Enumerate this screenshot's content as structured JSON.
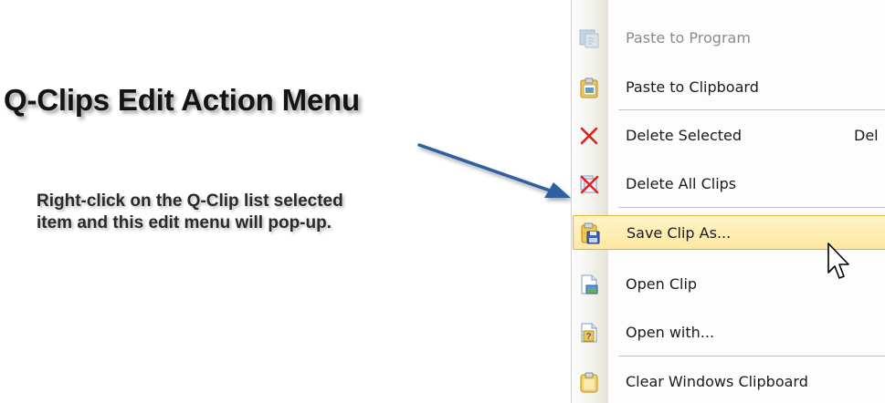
{
  "heading": "Q-Clips Edit Action Menu",
  "description": [
    "Right-click on the Q-Clip list selected",
    "item and this edit menu will pop-up."
  ],
  "menu": {
    "items": [
      {
        "label": "Paste to Program",
        "icon": "paste-to-program-icon",
        "state": "disabled"
      },
      {
        "label": "Paste to Clipboard",
        "icon": "clipboard-icon"
      },
      {
        "label": "Delete Selected",
        "shortcut": "Del",
        "icon": "red-x-icon"
      },
      {
        "label": "Delete All Clips",
        "icon": "delete-all-icon"
      },
      {
        "label": "Save Clip As...",
        "icon": "save-disk-icon",
        "state": "highlighted"
      },
      {
        "label": "Open Clip",
        "icon": "open-document-icon"
      },
      {
        "label": "Open with...",
        "icon": "question-document-icon"
      },
      {
        "label": "Clear Windows Clipboard",
        "icon": "empty-clipboard-icon"
      }
    ]
  },
  "colors": {
    "highlight_border": "#e0b23c",
    "highlight_fill": "#fde7a0",
    "arrow": "#2f5f9e",
    "delete_red": "#e0201c"
  }
}
